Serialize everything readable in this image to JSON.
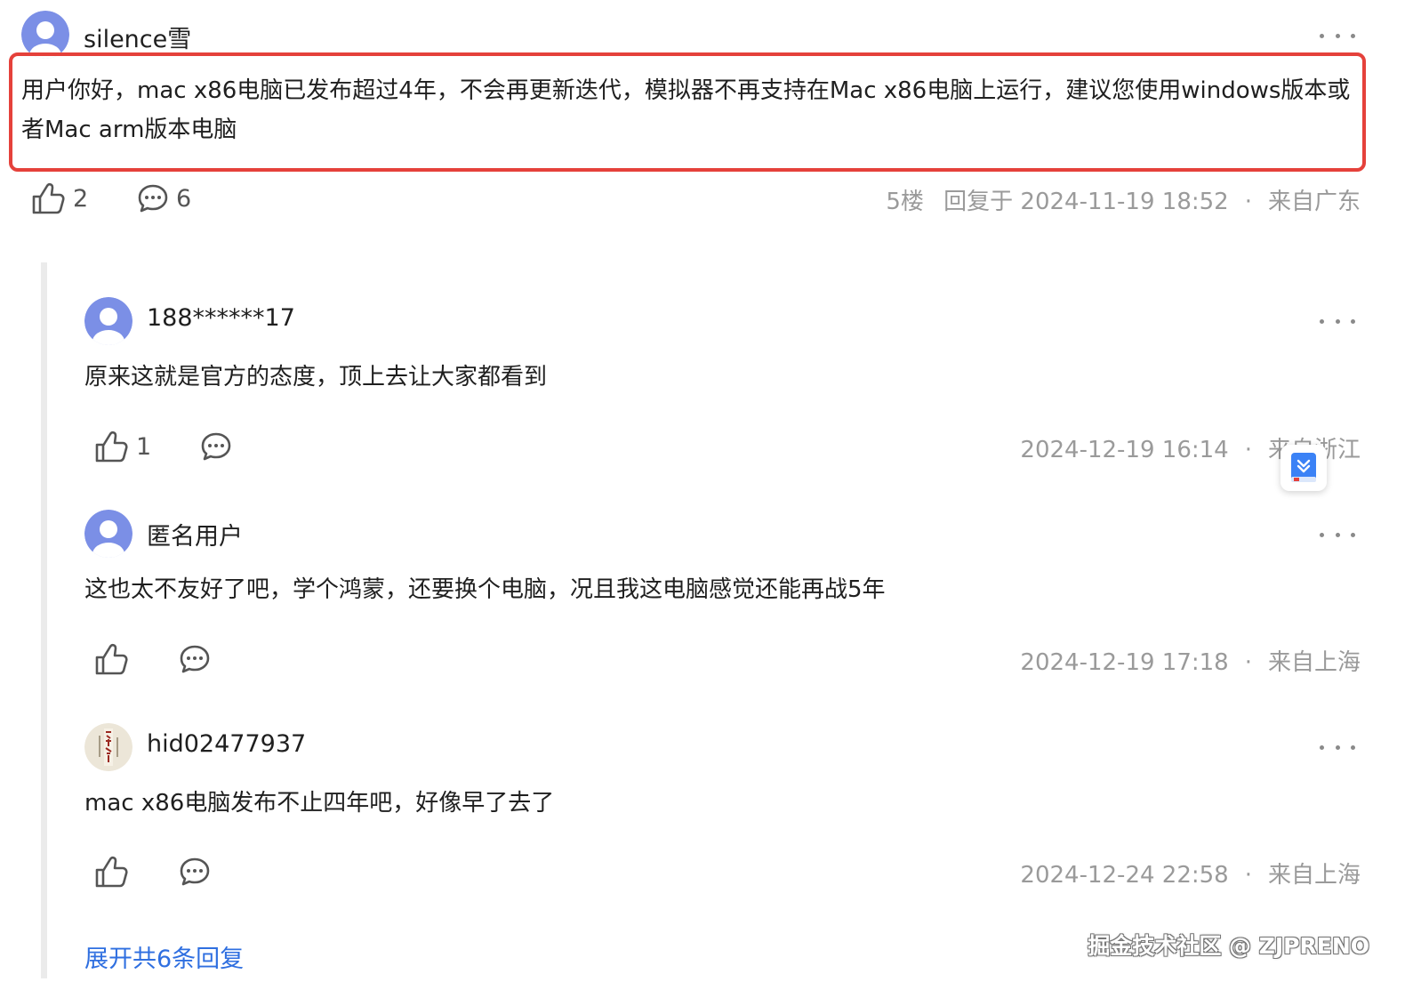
{
  "main_comment": {
    "username": "silence雪",
    "content": "用户你好，mac x86电脑已发布超过4年，不会再更新迭代，模拟器不再支持在Mac x86电脑上运行，建议您使用windows版本或者Mac arm版本电脑",
    "likes": "2",
    "replies": "6",
    "floor": "5楼",
    "reply_time": "回复于 2024-11-19 18:52",
    "location": "来自广东"
  },
  "replies": [
    {
      "username": "188******17",
      "content": "原来这就是官方的态度，顶上去让大家都看到",
      "likes": "1",
      "time": "2024-12-19 16:14",
      "location": "来自浙江"
    },
    {
      "username": "匿名用户",
      "content": "这也太不友好了吧，学个鸿蒙，还要换个电脑，况且我这电脑感觉还能再战5年",
      "likes": "",
      "time": "2024-12-19 17:18",
      "location": "来自上海"
    },
    {
      "username": "hid02477937",
      "content": "mac x86电脑发布不止四年吧，好像早了去了",
      "likes": "",
      "time": "2024-12-24 22:58",
      "location": "来自上海"
    }
  ],
  "separator": "·",
  "expand_label": "展开共6条回复",
  "watermark": "掘金技术社区 @ ZJPRENO",
  "colors": {
    "highlight_border": "#e5413b",
    "link_blue": "#2f6fe0",
    "meta_gray": "#9a9a9a",
    "avatar_blue": "#7b8fe6"
  }
}
